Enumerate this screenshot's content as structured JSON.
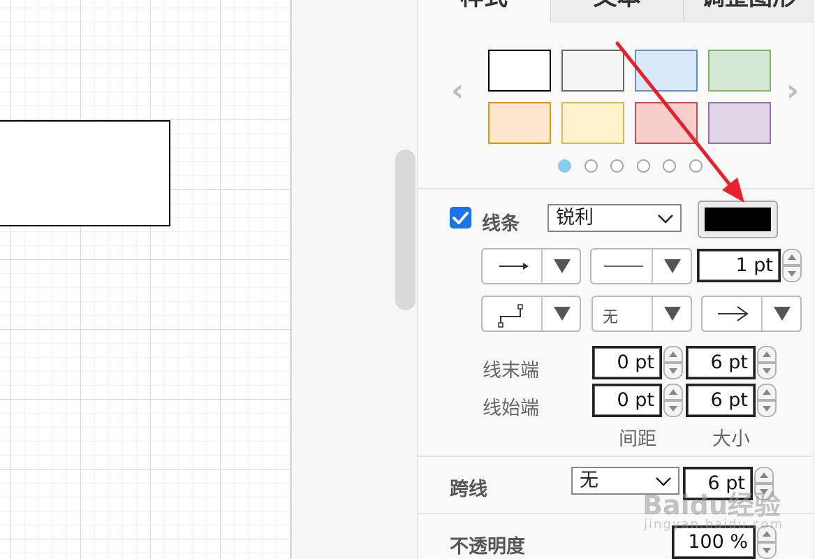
{
  "tabs": {
    "style": "样式",
    "text": "文本",
    "arrange": "调整图形"
  },
  "style_swatches": [
    {
      "fill": "#ffffff",
      "stroke": "#000000"
    },
    {
      "fill": "#f5f5f5",
      "stroke": "#666666"
    },
    {
      "fill": "#dae8fc",
      "stroke": "#6c8ebf"
    },
    {
      "fill": "#d5e8d4",
      "stroke": "#82b366"
    },
    {
      "fill": "#ffe6cc",
      "stroke": "#d79b00"
    },
    {
      "fill": "#fff2cc",
      "stroke": "#d6b656"
    },
    {
      "fill": "#f8cecc",
      "stroke": "#b85450"
    },
    {
      "fill": "#e1d5e7",
      "stroke": "#9673a6"
    }
  ],
  "swatch_pages": {
    "count": 6,
    "active": 1
  },
  "line": {
    "checkbox_checked": true,
    "label": "线条",
    "style_value": "锐利",
    "color": "#000000",
    "width_value": "1 pt",
    "pattern_none_label": "无",
    "end_label": "线末端",
    "start_label": "线始端",
    "end_spacing": "0 pt",
    "end_size": "6 pt",
    "start_spacing": "0 pt",
    "start_size": "6 pt",
    "spacing_caption": "间距",
    "size_caption": "大小"
  },
  "jumps": {
    "label": "跨线",
    "style_value": "无",
    "size_value": "6 pt"
  },
  "opacity": {
    "label": "不透明度",
    "value": "100 %"
  },
  "watermark": {
    "brand": "Baidu经验",
    "sub": "jingyan.baidu.com"
  },
  "colors": {
    "accent": "#1a73e8",
    "annotation_arrow": "#e8202b"
  }
}
